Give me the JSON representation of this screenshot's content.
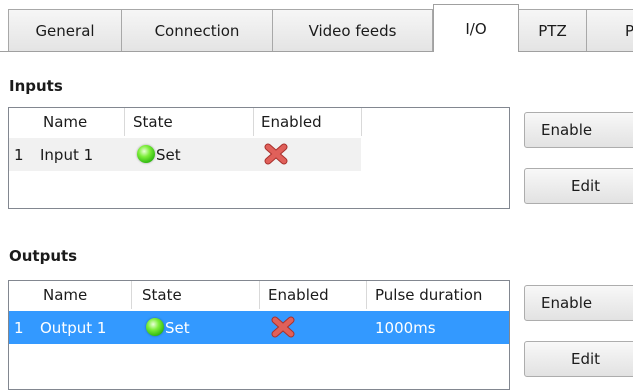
{
  "tabs": [
    {
      "label": "General",
      "active": false
    },
    {
      "label": "Connection",
      "active": false
    },
    {
      "label": "Video feeds",
      "active": false
    },
    {
      "label": "I/O",
      "active": true
    },
    {
      "label": "PTZ",
      "active": false
    },
    {
      "label": "P",
      "active": false
    }
  ],
  "inputs": {
    "title": "Inputs",
    "columns": [
      "Name",
      "State",
      "Enabled"
    ],
    "rows": [
      {
        "index": "1",
        "name": "Input 1",
        "state": "Set",
        "state_icon": "green-led-icon",
        "enabled_icon": "red-x-icon"
      }
    ],
    "enable_button": "Enable",
    "edit_button": "Edit"
  },
  "outputs": {
    "title": "Outputs",
    "columns": [
      "Name",
      "State",
      "Enabled",
      "Pulse duration"
    ],
    "rows": [
      {
        "index": "1",
        "name": "Output 1",
        "state": "Set",
        "state_icon": "green-led-icon",
        "enabled_icon": "red-x-icon",
        "pulse_duration": "1000ms",
        "selected": true
      }
    ],
    "enable_button": "Enable",
    "edit_button": "Edit"
  },
  "colors": {
    "selection": "#3399ff",
    "row_background": "#f1f1f1",
    "led_green": "#2eb80f",
    "x_red": "#d9534f"
  }
}
